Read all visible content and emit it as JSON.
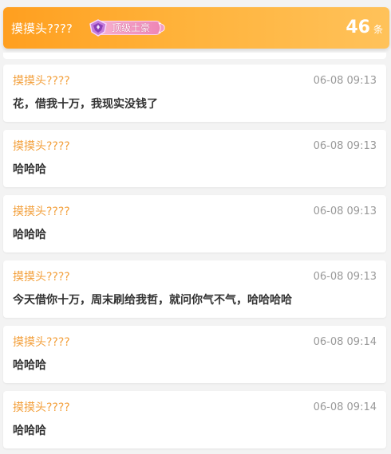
{
  "header": {
    "title": "摸摸头????",
    "badge_label": "顶级土豪",
    "count": "46",
    "count_unit": "条"
  },
  "messages": [
    {
      "user": "摸摸头????",
      "time": "06-08 09:13",
      "text": "花，借我十万，我现实没钱了"
    },
    {
      "user": "摸摸头????",
      "time": "06-08 09:13",
      "text": "哈哈哈"
    },
    {
      "user": "摸摸头????",
      "time": "06-08 09:13",
      "text": "哈哈哈"
    },
    {
      "user": "摸摸头????",
      "time": "06-08 09:13",
      "text": "今天借你十万，周末刷给我哲，就问你气不气，哈哈哈哈"
    },
    {
      "user": "摸摸头????",
      "time": "06-08 09:14",
      "text": "哈哈哈"
    },
    {
      "user": "摸摸头????",
      "time": "06-08 09:14",
      "text": "哈哈哈"
    }
  ],
  "colors": {
    "header_gradient_start": "#ff9f1f",
    "header_gradient_end": "#ffc25a",
    "username": "#f3a03c",
    "time": "#999999",
    "message_text": "#333333",
    "badge_pink": "#ee84b5"
  }
}
